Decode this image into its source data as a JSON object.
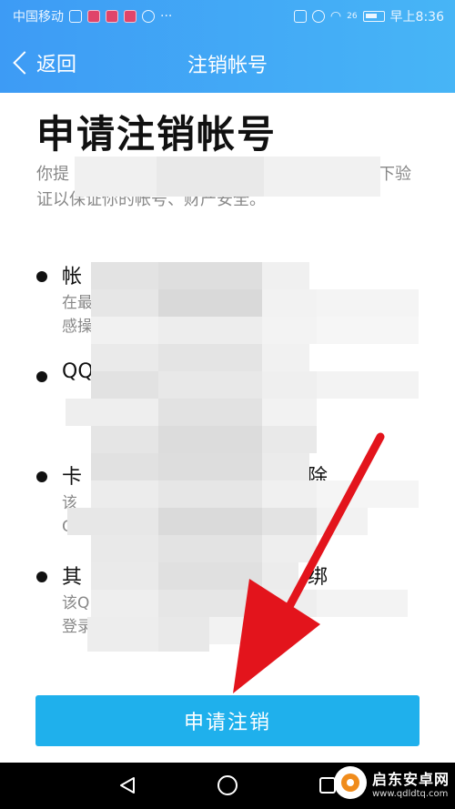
{
  "status_bar": {
    "carrier": "中国移动",
    "signal": "26",
    "time": "早上8:36"
  },
  "nav": {
    "back_label": "返回",
    "title": "注销帐号"
  },
  "page": {
    "title": "申请注销帐号",
    "intro_start": "你提",
    "intro_end": "下验",
    "intro_line2": "证以保证你的帐号、财产安全。"
  },
  "items": [
    {
      "title": "帐",
      "desc_line1": "在最",
      "desc_line2": "感操"
    },
    {
      "title": "QQ",
      "desc_line1": "",
      "desc_line2": ""
    },
    {
      "title": "卡",
      "title_end": "解除",
      "desc_line1": "该",
      "desc_line2": "Q"
    },
    {
      "title": "其",
      "title_end": "绑",
      "desc_line1": "该Q",
      "desc_line2": "登录"
    }
  ],
  "cta_label": "申请注销",
  "system_nav": {
    "back": "back-icon",
    "home": "home-icon",
    "recent": "recent-icon"
  },
  "watermark": {
    "name": "启东安卓网",
    "url": "www.qdldtq.com"
  },
  "colors": {
    "header": "#3d9bf5",
    "button": "#1fb0ec",
    "arrow": "#e3141c"
  }
}
